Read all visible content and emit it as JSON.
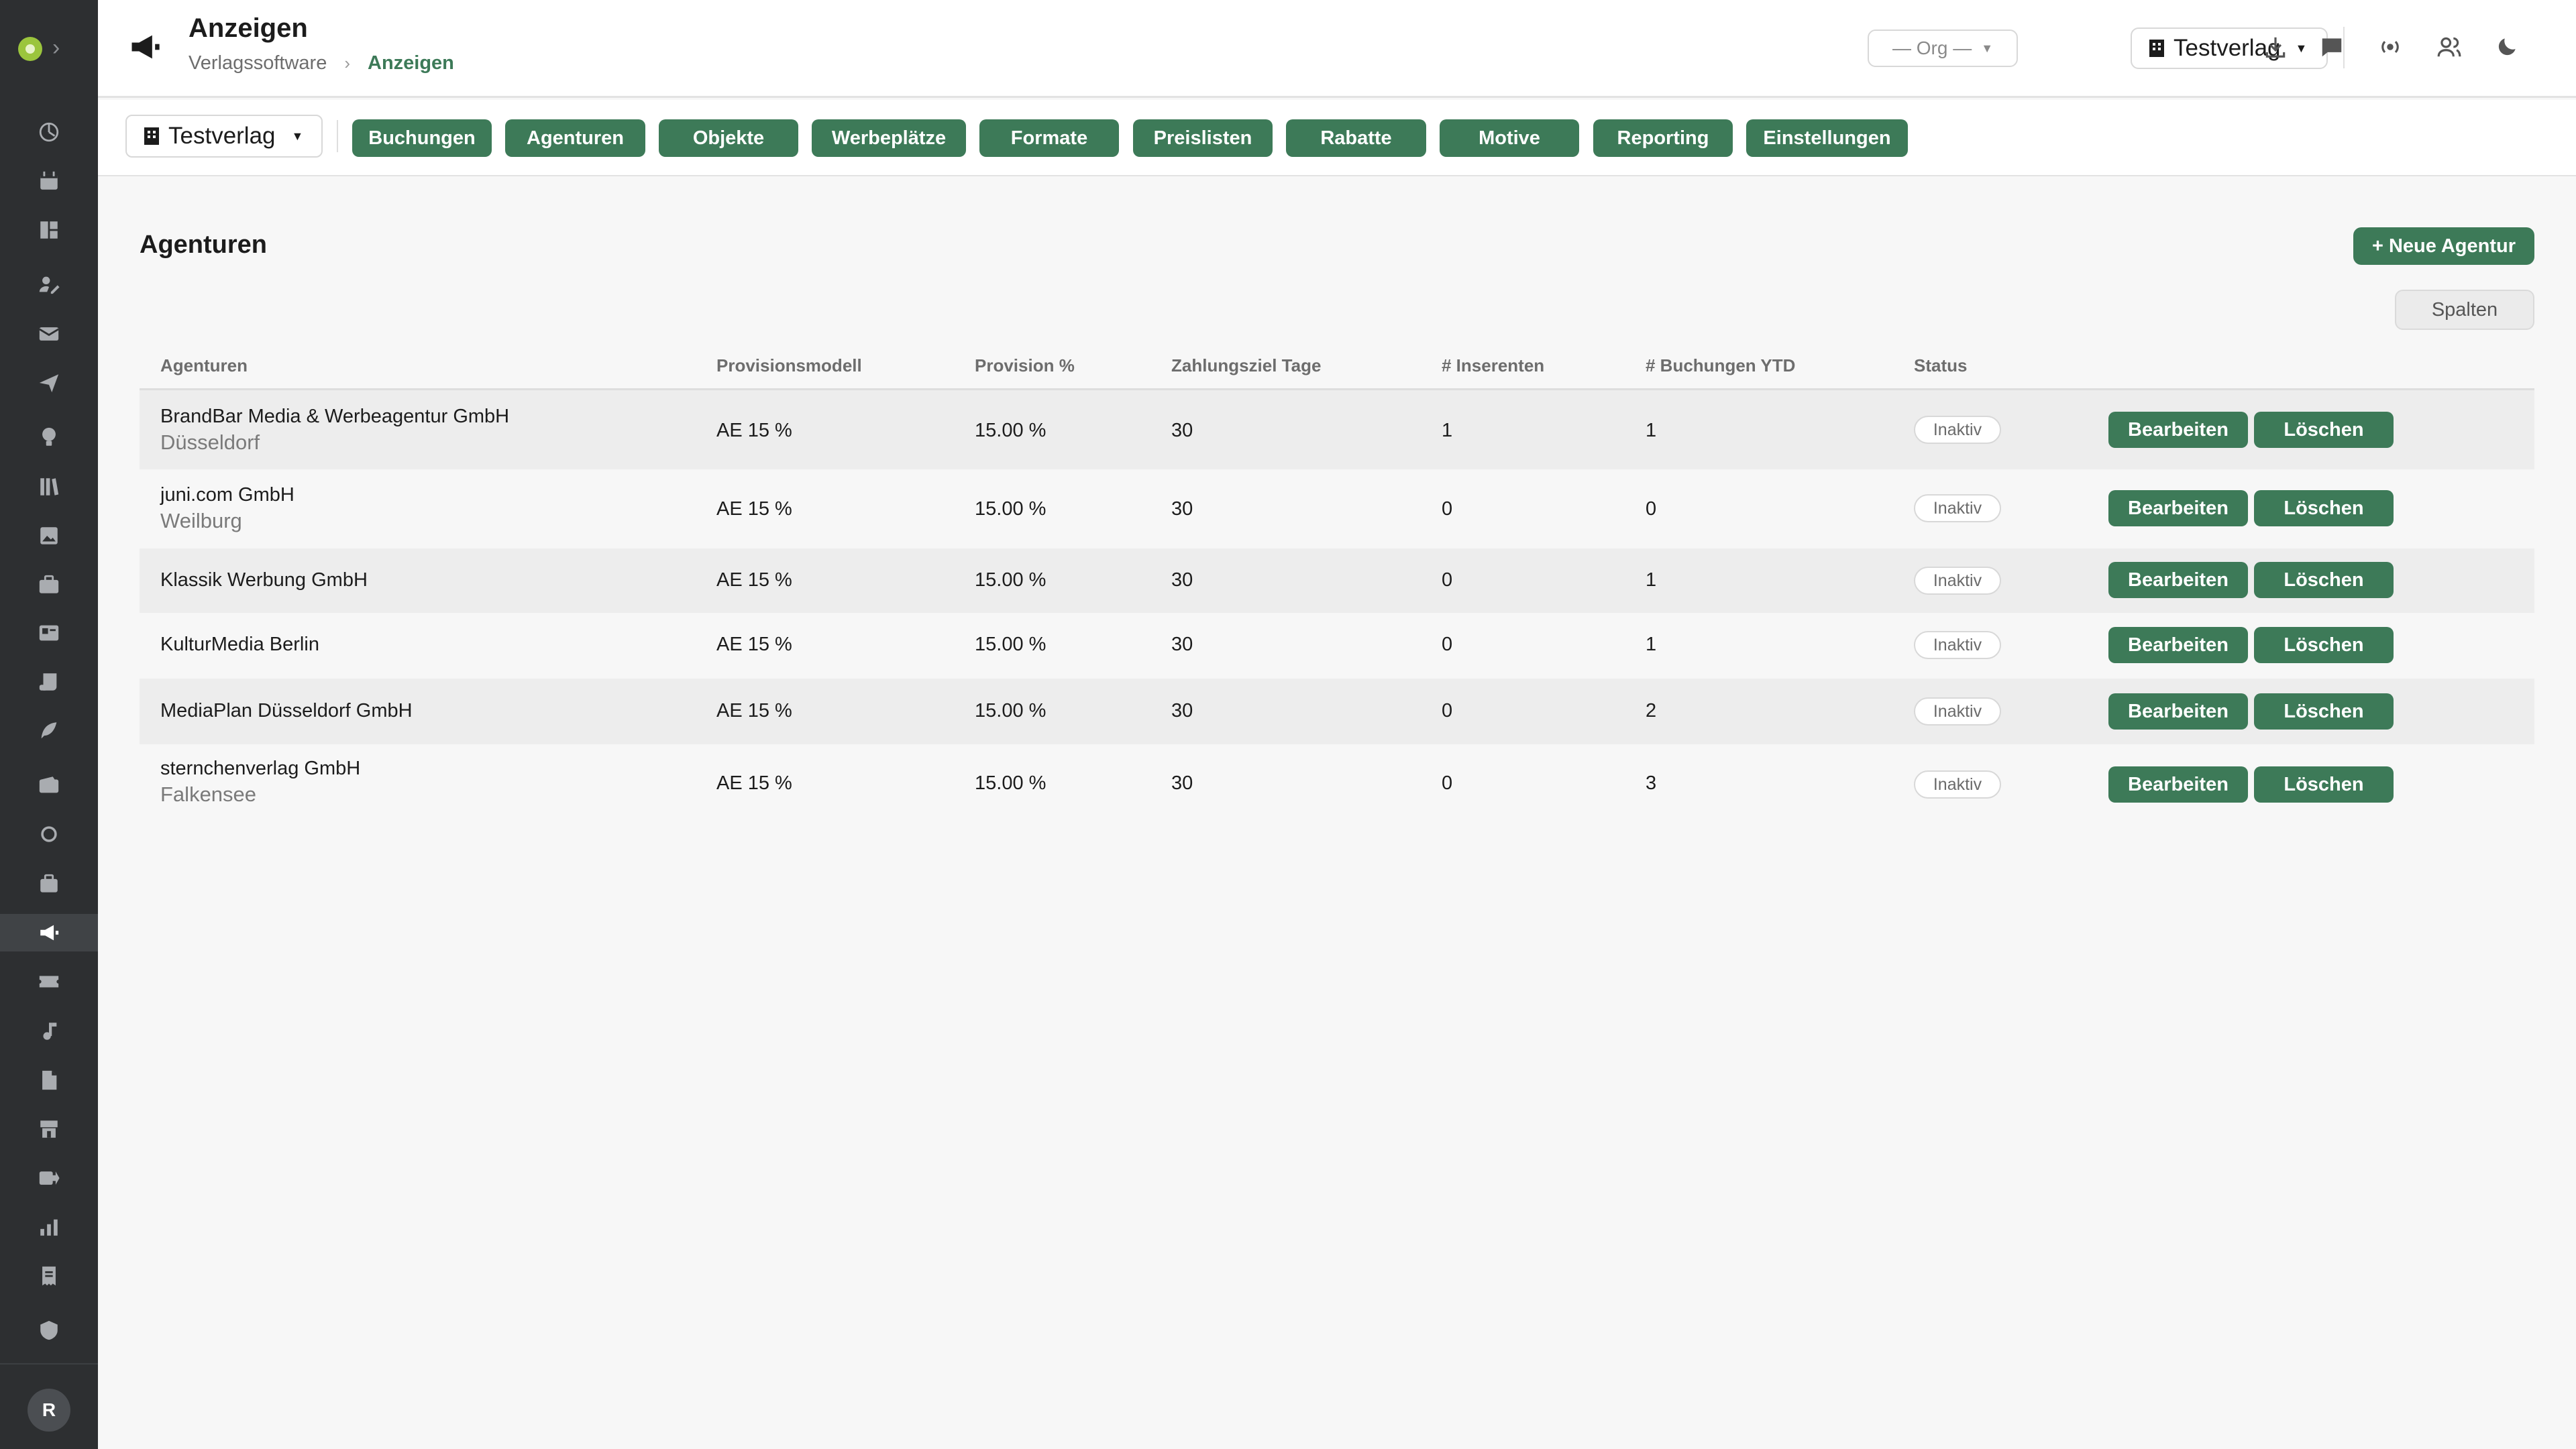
{
  "header": {
    "title": "Anzeigen",
    "breadcrumb": [
      "Verlagssoftware",
      "Anzeigen"
    ],
    "breadcrumb_separator": "›",
    "org_select": "— Org —",
    "verlag_select": "Testverlag",
    "actions": [
      "download-icon",
      "chat-icon",
      "broadcast-icon",
      "users-icon",
      "moon-icon"
    ]
  },
  "sidebar": {
    "expand": "›",
    "avatar": "R",
    "active_item": "anzeigen",
    "items": [
      "dashboard-icon",
      "calendar-icon",
      "layout-icon",
      "edit-user-icon",
      "mail-icon",
      "send-icon",
      "bulb-icon",
      "library-icon",
      "image-icon",
      "briefcase-icon",
      "id-card-icon",
      "scroll-icon",
      "feather-icon",
      "wallet-icon",
      "circle-icon",
      "bag-icon",
      "megaphone-icon",
      "ticket-icon",
      "music-icon",
      "document-icon",
      "store-icon",
      "forward-icon",
      "bar-chart-icon",
      "receipt-icon",
      "shield-icon"
    ]
  },
  "tabbar": {
    "verlag": "Testverlag",
    "tabs": [
      "Buchungen",
      "Agenturen",
      "Objekte",
      "Werbeplätze",
      "Formate",
      "Preislisten",
      "Rabatte",
      "Motive",
      "Reporting",
      "Einstellungen"
    ],
    "active": "Agenturen"
  },
  "main": {
    "title": "Agenturen",
    "new_button": "+ Neue Agentur",
    "columns_button": "Spalten",
    "table": {
      "headers": [
        "Agenturen",
        "Provisionsmodell",
        "Provision %",
        "Zahlungsziel Tage",
        "# Inserenten",
        "# Buchungen YTD",
        "Status"
      ],
      "edit_label": "Bearbeiten",
      "delete_label": "Löschen",
      "rows": [
        {
          "name": "BrandBar Media & Werbeagentur GmbH",
          "city": "Düsseldorf",
          "model": "AE 15 %",
          "provision": "15.00 %",
          "term": "30",
          "advertisers": "1",
          "bookings": "1",
          "status": "Inaktiv"
        },
        {
          "name": "juni.com GmbH",
          "city": "Weilburg",
          "model": "AE 15 %",
          "provision": "15.00 %",
          "term": "30",
          "advertisers": "0",
          "bookings": "0",
          "status": "Inaktiv"
        },
        {
          "name": "Klassik Werbung GmbH",
          "city": "",
          "model": "AE 15 %",
          "provision": "15.00 %",
          "term": "30",
          "advertisers": "0",
          "bookings": "1",
          "status": "Inaktiv"
        },
        {
          "name": "KulturMedia Berlin",
          "city": "",
          "model": "AE 15 %",
          "provision": "15.00 %",
          "term": "30",
          "advertisers": "0",
          "bookings": "1",
          "status": "Inaktiv"
        },
        {
          "name": "MediaPlan Düsseldorf GmbH",
          "city": "",
          "model": "AE 15 %",
          "provision": "15.00 %",
          "term": "30",
          "advertisers": "0",
          "bookings": "2",
          "status": "Inaktiv"
        },
        {
          "name": "sternchenverlag GmbH",
          "city": "Falkensee",
          "model": "AE 15 %",
          "provision": "15.00 %",
          "term": "30",
          "advertisers": "0",
          "bookings": "3",
          "status": "Inaktiv"
        }
      ]
    }
  },
  "colors": {
    "accent": "#3d7a58",
    "sidebar": "#2d2f31",
    "background": "#f7f7f7"
  }
}
